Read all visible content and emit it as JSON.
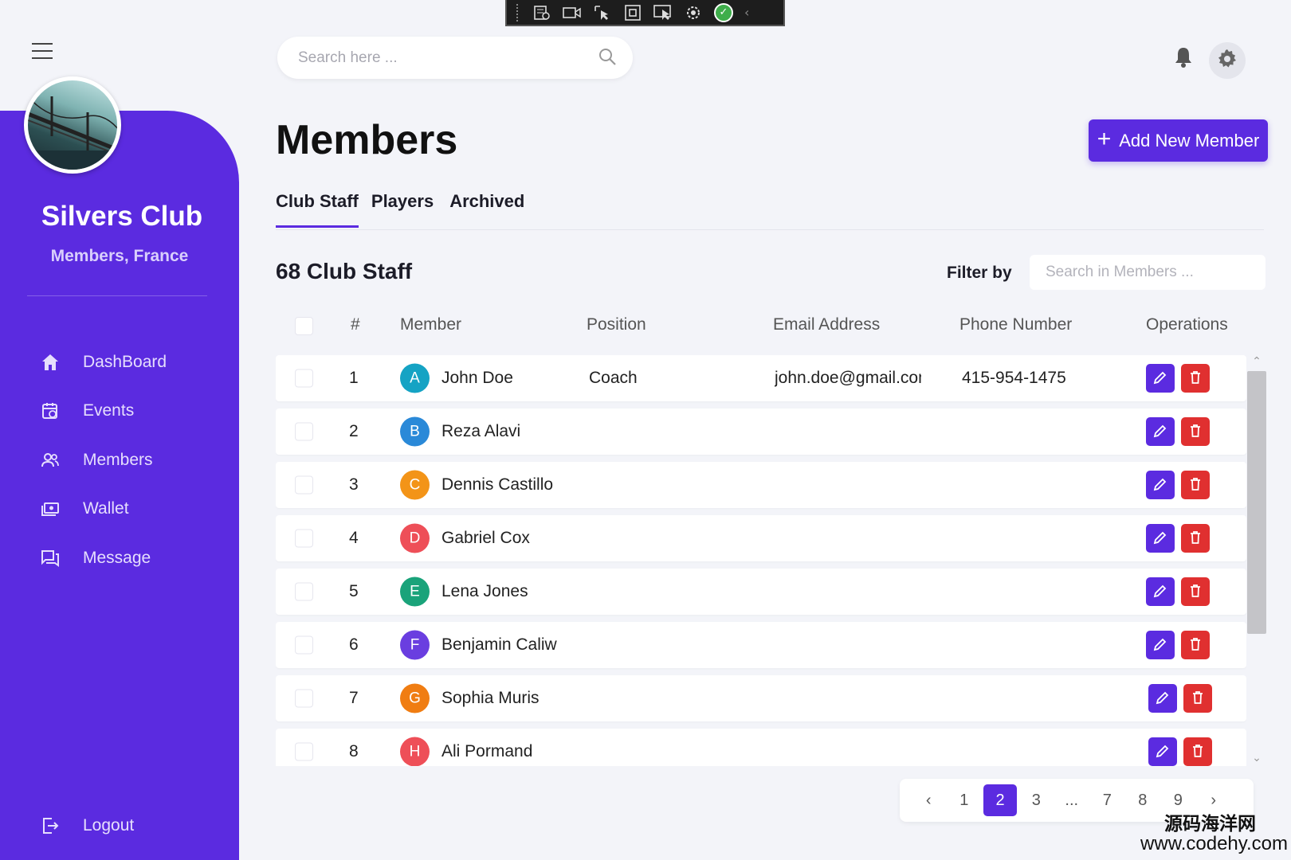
{
  "capture_toolbar": {
    "icons": [
      "region-capture-icon",
      "video-icon",
      "pointer-select-icon",
      "window-capture-icon",
      "screen-pointer-icon",
      "gear-pin-icon",
      "confirm-icon",
      "collapse-chevron-icon"
    ]
  },
  "sidebar": {
    "club_name": "Silvers Club",
    "club_subtitle": "Members, France",
    "nav": [
      {
        "label": "DashBoard",
        "icon": "home-icon"
      },
      {
        "label": "Events",
        "icon": "calendar-icon"
      },
      {
        "label": "Members",
        "icon": "users-icon"
      },
      {
        "label": "Wallet",
        "icon": "wallet-icon"
      },
      {
        "label": "Message",
        "icon": "message-icon"
      }
    ],
    "logout_label": "Logout"
  },
  "header": {
    "search_placeholder": "Search here ..."
  },
  "page": {
    "title": "Members",
    "add_button": "Add New Member",
    "tabs": [
      {
        "label": "Club Staff",
        "active": true
      },
      {
        "label": "Players",
        "active": false
      },
      {
        "label": "Archived",
        "active": false
      }
    ],
    "count_label": "68 Club Staff",
    "filter_label": "Filter by",
    "filter_placeholder": "Search in Members ..."
  },
  "table": {
    "columns": [
      "#",
      "Member",
      "Position",
      "Email Address",
      "Phone Number",
      "Operations"
    ],
    "rows": [
      {
        "num": "1",
        "initial": "A",
        "color": "#15a3c4",
        "name": "John Doe",
        "position": "Coach",
        "email": "john.doe@gmail.com",
        "phone": "415-954-1475"
      },
      {
        "num": "2",
        "initial": "B",
        "color": "#2a89d8",
        "name": "Reza Alavi",
        "position": "",
        "email": "",
        "phone": ""
      },
      {
        "num": "3",
        "initial": "C",
        "color": "#f39418",
        "name": "Dennis Castillo",
        "position": "",
        "email": "",
        "phone": ""
      },
      {
        "num": "4",
        "initial": "D",
        "color": "#ee4f58",
        "name": "Gabriel Cox",
        "position": "",
        "email": "",
        "phone": ""
      },
      {
        "num": "5",
        "initial": "E",
        "color": "#1aa37a",
        "name": "Lena Jones",
        "position": "",
        "email": "",
        "phone": ""
      },
      {
        "num": "6",
        "initial": "F",
        "color": "#6a3ee0",
        "name": "Benjamin Caliw",
        "position": "",
        "email": "",
        "phone": ""
      },
      {
        "num": "7",
        "initial": "G",
        "color": "#f07d12",
        "name": "Sophia Muris",
        "position": "",
        "email": "",
        "phone": ""
      },
      {
        "num": "8",
        "initial": "H",
        "color": "#ee4f58",
        "name": "Ali Pormand",
        "position": "",
        "email": "",
        "phone": ""
      }
    ]
  },
  "pagination": {
    "prev": "‹",
    "pages": [
      "1",
      "2",
      "3",
      "...",
      "7",
      "8",
      "9"
    ],
    "active": "2",
    "next": "›"
  },
  "watermark": {
    "line1": "源码海洋网",
    "line2": "www.codehy.com"
  },
  "colors": {
    "accent": "#5b2be0",
    "danger": "#e03030",
    "background": "#f3f4f9"
  }
}
